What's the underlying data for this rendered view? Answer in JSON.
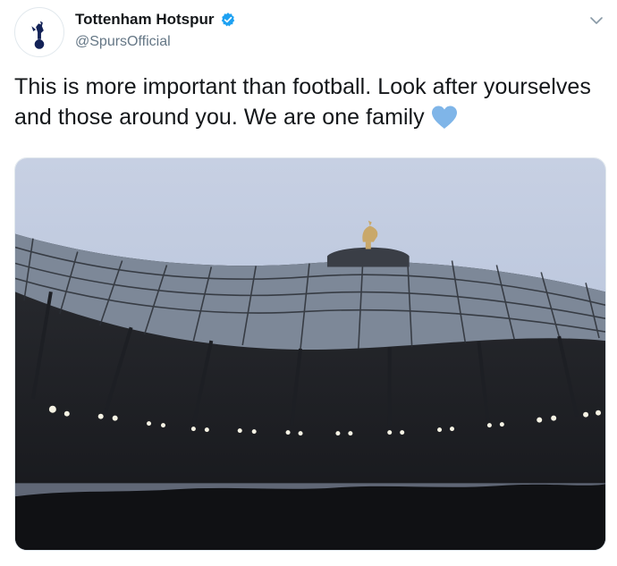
{
  "tweet": {
    "display_name": "Tottenham Hotspur",
    "handle": "@SpursOfficial",
    "verified": true,
    "text": "This is more important than football. Look after yourselves and those around you. We are one family",
    "emoji": "blue-heart",
    "media": {
      "subject": "stadium-roof-photo"
    }
  },
  "icons": {
    "avatar": "cockerel-logo-icon",
    "verified": "verified-badge-icon",
    "menu": "chevron-down-icon",
    "heart": "blue-heart-icon"
  },
  "colors": {
    "verified": "#1da1f2",
    "heart": "#7fb5e8",
    "handle": "#657786",
    "text": "#14171a"
  }
}
